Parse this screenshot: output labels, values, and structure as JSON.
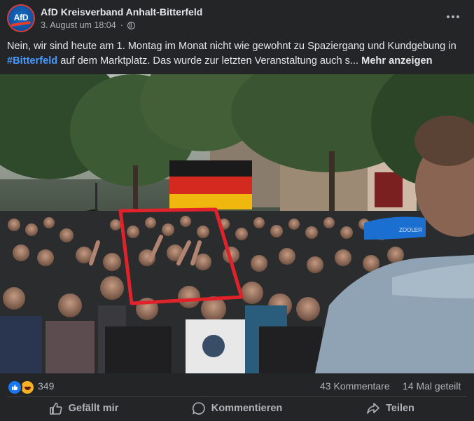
{
  "post": {
    "page_name": "AfD Kreisverband Anhalt-Bitterfeld",
    "avatar_text": "AfD",
    "date": "3. August um 18:04",
    "separator": "·",
    "text_before": "Nein, wir sind heute am 1. Montag im Monat nicht wie gewohnt zu Spaziergang und Kundgebung in ",
    "hashtag": "#Bitterfeld",
    "text_after": " auf dem Marktplatz. Das wurde zur letzten Veranstaltung auch s... ",
    "show_more": "Mehr anzeigen"
  },
  "photo": {
    "description_icon": "crowd-photo",
    "highlight_color": "#e0232b",
    "banner_text": "ZOOLER"
  },
  "reactions": {
    "count": "349",
    "icons": [
      "like-icon",
      "haha-icon"
    ],
    "comments": "43 Kommentare",
    "shares": "14 Mal geteilt"
  },
  "actions": {
    "like": "Gefällt mir",
    "comment": "Kommentieren",
    "share": "Teilen"
  },
  "colors": {
    "background": "#242526",
    "text": "#e4e6eb",
    "secondary": "#b0b3b8",
    "link": "#4599ff"
  }
}
